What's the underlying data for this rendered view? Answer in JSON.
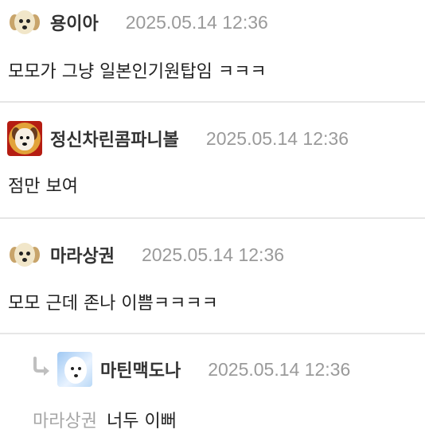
{
  "comments": [
    {
      "nickname": "용이아",
      "timestamp": "2025.05.14 12:36",
      "text": "모모가 그냥 일본인기원탑임 ㅋㅋㅋ",
      "avatar": "cream-puppy-avatar"
    },
    {
      "nickname": "정신차린콤파니볼",
      "timestamp": "2025.05.14 12:36",
      "text": "점만 보여",
      "avatar": "red-framed-dog-avatar"
    },
    {
      "nickname": "마라상권",
      "timestamp": "2025.05.14 12:36",
      "text": "모모 근데 존나 이쁨ㅋㅋㅋㅋ",
      "avatar": "cream-puppy-avatar"
    }
  ],
  "reply": {
    "nickname": "마틴맥도나",
    "timestamp": "2025.05.14 12:36",
    "mention": "마라상권",
    "text": "너두 이뻐",
    "avatar": "blue-fluffy-dog-avatar",
    "icon": "reply-arrow-icon"
  },
  "colors": {
    "nickname": "#333333",
    "timestamp": "#9a9a9a",
    "mention": "#a6a6a6",
    "divider": "#e6e6e6",
    "reply_arrow": "#bfbfbf"
  }
}
